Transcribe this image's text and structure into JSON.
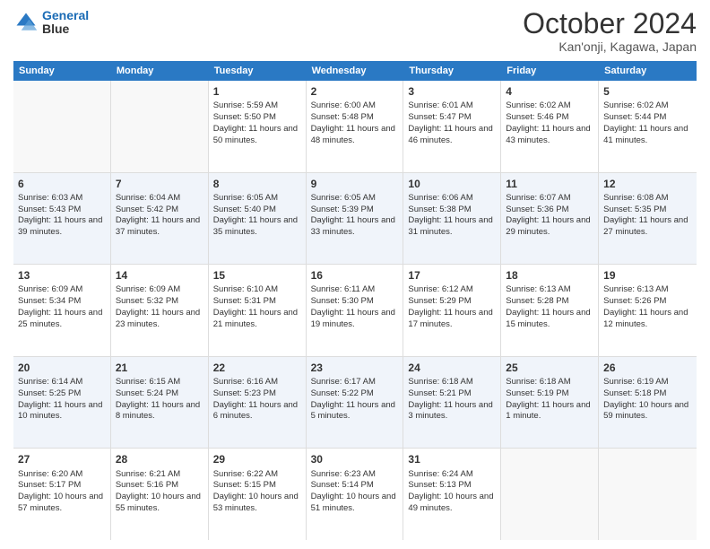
{
  "header": {
    "logo_line1": "General",
    "logo_line2": "Blue",
    "month": "October 2024",
    "location": "Kan'onji, Kagawa, Japan"
  },
  "weekdays": [
    "Sunday",
    "Monday",
    "Tuesday",
    "Wednesday",
    "Thursday",
    "Friday",
    "Saturday"
  ],
  "rows": [
    [
      {
        "day": "",
        "info": ""
      },
      {
        "day": "",
        "info": ""
      },
      {
        "day": "1",
        "info": "Sunrise: 5:59 AM\nSunset: 5:50 PM\nDaylight: 11 hours and 50 minutes."
      },
      {
        "day": "2",
        "info": "Sunrise: 6:00 AM\nSunset: 5:48 PM\nDaylight: 11 hours and 48 minutes."
      },
      {
        "day": "3",
        "info": "Sunrise: 6:01 AM\nSunset: 5:47 PM\nDaylight: 11 hours and 46 minutes."
      },
      {
        "day": "4",
        "info": "Sunrise: 6:02 AM\nSunset: 5:46 PM\nDaylight: 11 hours and 43 minutes."
      },
      {
        "day": "5",
        "info": "Sunrise: 6:02 AM\nSunset: 5:44 PM\nDaylight: 11 hours and 41 minutes."
      }
    ],
    [
      {
        "day": "6",
        "info": "Sunrise: 6:03 AM\nSunset: 5:43 PM\nDaylight: 11 hours and 39 minutes."
      },
      {
        "day": "7",
        "info": "Sunrise: 6:04 AM\nSunset: 5:42 PM\nDaylight: 11 hours and 37 minutes."
      },
      {
        "day": "8",
        "info": "Sunrise: 6:05 AM\nSunset: 5:40 PM\nDaylight: 11 hours and 35 minutes."
      },
      {
        "day": "9",
        "info": "Sunrise: 6:05 AM\nSunset: 5:39 PM\nDaylight: 11 hours and 33 minutes."
      },
      {
        "day": "10",
        "info": "Sunrise: 6:06 AM\nSunset: 5:38 PM\nDaylight: 11 hours and 31 minutes."
      },
      {
        "day": "11",
        "info": "Sunrise: 6:07 AM\nSunset: 5:36 PM\nDaylight: 11 hours and 29 minutes."
      },
      {
        "day": "12",
        "info": "Sunrise: 6:08 AM\nSunset: 5:35 PM\nDaylight: 11 hours and 27 minutes."
      }
    ],
    [
      {
        "day": "13",
        "info": "Sunrise: 6:09 AM\nSunset: 5:34 PM\nDaylight: 11 hours and 25 minutes."
      },
      {
        "day": "14",
        "info": "Sunrise: 6:09 AM\nSunset: 5:32 PM\nDaylight: 11 hours and 23 minutes."
      },
      {
        "day": "15",
        "info": "Sunrise: 6:10 AM\nSunset: 5:31 PM\nDaylight: 11 hours and 21 minutes."
      },
      {
        "day": "16",
        "info": "Sunrise: 6:11 AM\nSunset: 5:30 PM\nDaylight: 11 hours and 19 minutes."
      },
      {
        "day": "17",
        "info": "Sunrise: 6:12 AM\nSunset: 5:29 PM\nDaylight: 11 hours and 17 minutes."
      },
      {
        "day": "18",
        "info": "Sunrise: 6:13 AM\nSunset: 5:28 PM\nDaylight: 11 hours and 15 minutes."
      },
      {
        "day": "19",
        "info": "Sunrise: 6:13 AM\nSunset: 5:26 PM\nDaylight: 11 hours and 12 minutes."
      }
    ],
    [
      {
        "day": "20",
        "info": "Sunrise: 6:14 AM\nSunset: 5:25 PM\nDaylight: 11 hours and 10 minutes."
      },
      {
        "day": "21",
        "info": "Sunrise: 6:15 AM\nSunset: 5:24 PM\nDaylight: 11 hours and 8 minutes."
      },
      {
        "day": "22",
        "info": "Sunrise: 6:16 AM\nSunset: 5:23 PM\nDaylight: 11 hours and 6 minutes."
      },
      {
        "day": "23",
        "info": "Sunrise: 6:17 AM\nSunset: 5:22 PM\nDaylight: 11 hours and 5 minutes."
      },
      {
        "day": "24",
        "info": "Sunrise: 6:18 AM\nSunset: 5:21 PM\nDaylight: 11 hours and 3 minutes."
      },
      {
        "day": "25",
        "info": "Sunrise: 6:18 AM\nSunset: 5:19 PM\nDaylight: 11 hours and 1 minute."
      },
      {
        "day": "26",
        "info": "Sunrise: 6:19 AM\nSunset: 5:18 PM\nDaylight: 10 hours and 59 minutes."
      }
    ],
    [
      {
        "day": "27",
        "info": "Sunrise: 6:20 AM\nSunset: 5:17 PM\nDaylight: 10 hours and 57 minutes."
      },
      {
        "day": "28",
        "info": "Sunrise: 6:21 AM\nSunset: 5:16 PM\nDaylight: 10 hours and 55 minutes."
      },
      {
        "day": "29",
        "info": "Sunrise: 6:22 AM\nSunset: 5:15 PM\nDaylight: 10 hours and 53 minutes."
      },
      {
        "day": "30",
        "info": "Sunrise: 6:23 AM\nSunset: 5:14 PM\nDaylight: 10 hours and 51 minutes."
      },
      {
        "day": "31",
        "info": "Sunrise: 6:24 AM\nSunset: 5:13 PM\nDaylight: 10 hours and 49 minutes."
      },
      {
        "day": "",
        "info": ""
      },
      {
        "day": "",
        "info": ""
      }
    ]
  ]
}
